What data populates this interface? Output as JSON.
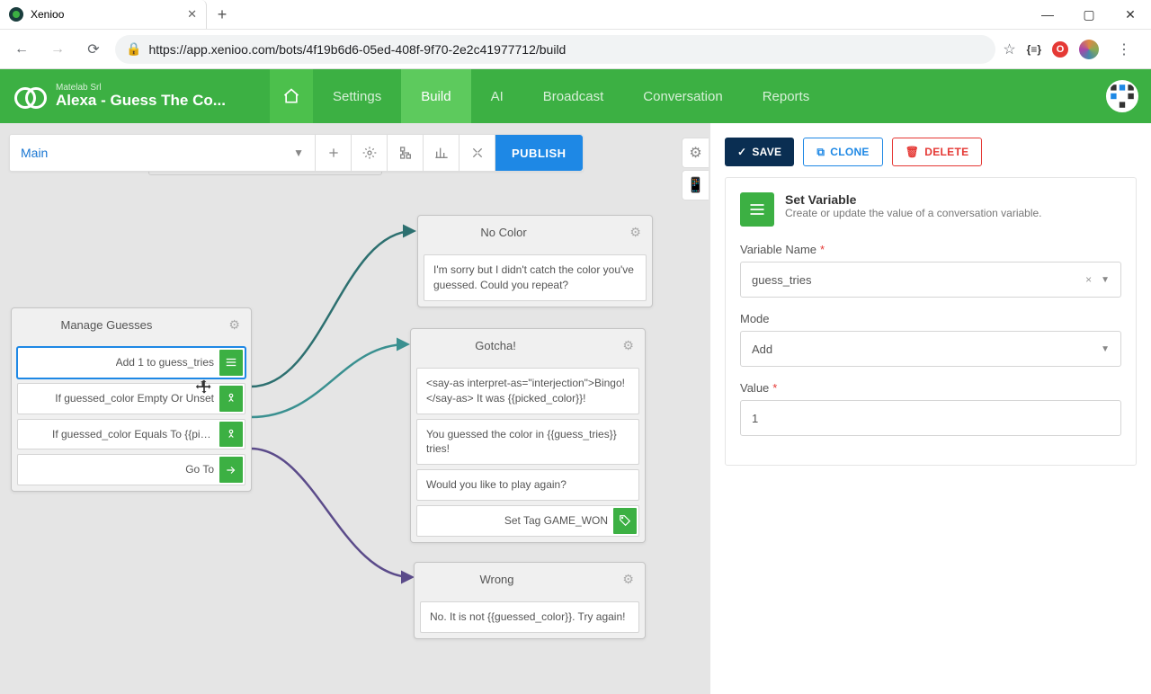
{
  "browser": {
    "tab_title": "Xenioo",
    "url": "https://app.xenioo.com/bots/4f19b6d6-05ed-408f-9f70-2e2c41977712/build",
    "bracket_ext": "{≡}"
  },
  "header": {
    "org": "Matelab Srl",
    "bot_name": "Alexa - Guess The Co...",
    "menu": {
      "settings": "Settings",
      "build": "Build",
      "ai": "AI",
      "broadcast": "Broadcast",
      "conversation": "Conversation",
      "reports": "Reports"
    }
  },
  "toolbar": {
    "flow": "Main",
    "publish": "PUBLISH"
  },
  "nodes": {
    "manage": {
      "title": "Manage Guesses",
      "a1": "Add 1 to guess_tries",
      "a2": "If guessed_color Empty Or Unset",
      "a3": "If guessed_color Equals To {{picked_c...",
      "a4": "Go To"
    },
    "nocolor": {
      "title": "No Color",
      "a1": "I'm sorry but I didn't catch the color you've guessed. Could you repeat?"
    },
    "gotcha": {
      "title": "Gotcha!",
      "a1": "<say-as interpret-as=\"interjection\">Bingo!</say-as> It was {{picked_color}}!",
      "a2": "You guessed the color in {{guess_tries}} tries!",
      "a3": "Would you like to play again?",
      "a4": "Set Tag GAME_WON"
    },
    "wrong": {
      "title": "Wrong",
      "a1": "No. It is not {{guessed_color}}. Try again!"
    }
  },
  "panel": {
    "save": "SAVE",
    "clone": "CLONE",
    "delete": "DELETE",
    "action_title": "Set Variable",
    "action_desc": "Create or update the value of a conversation variable.",
    "var_label": "Variable Name",
    "var_value": "guess_tries",
    "mode_label": "Mode",
    "mode_value": "Add",
    "value_label": "Value",
    "value_value": "1"
  }
}
